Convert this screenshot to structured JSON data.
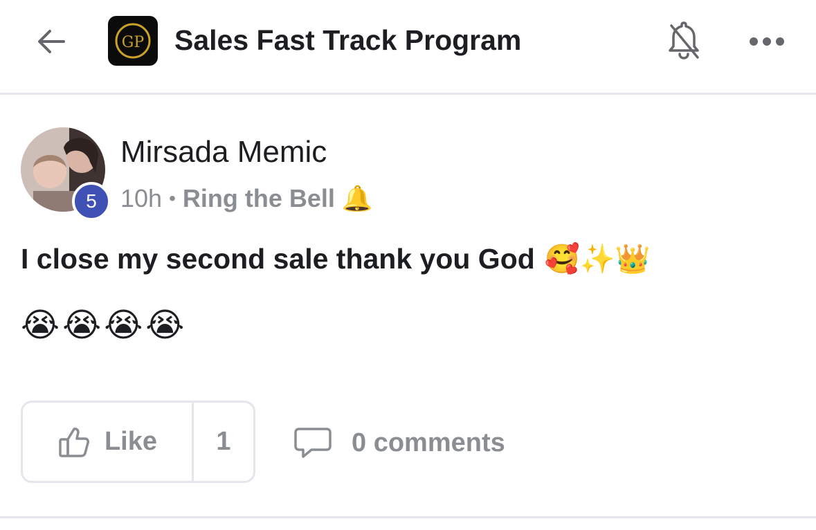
{
  "header": {
    "group_title": "Sales Fast Track Program",
    "logo_text": "GP",
    "icons": [
      "back-arrow-icon",
      "group-logo",
      "notifications-off-icon",
      "more-options-icon"
    ]
  },
  "post": {
    "author": "Mirsada Memic",
    "level": "5",
    "time": "10h",
    "separator": "•",
    "category": "Ring the Bell",
    "category_emoji": "🔔",
    "text": "I close my second sale thank you God",
    "text_emojis": [
      "🥰",
      "✨",
      "👑"
    ],
    "extra_emojis": [
      "😭",
      "😭",
      "😭",
      "😭"
    ]
  },
  "actions": {
    "like_label": "Like",
    "like_count": "1",
    "comments_label": "0 comments"
  },
  "colors": {
    "badge": "#3f51b5",
    "muted_text": "#8a8d91",
    "primary_text": "#1c1e21",
    "divider": "#e4e6eb"
  }
}
